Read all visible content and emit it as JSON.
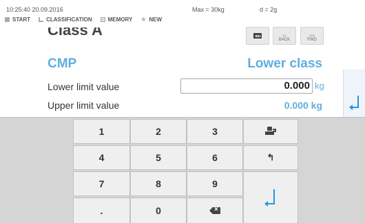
{
  "status": {
    "time": "10:25:40 20.09.2016",
    "max": "Max = 30kg",
    "d": "d = 2g"
  },
  "breadcrumb": [
    {
      "label": "START",
      "icon": "home-icon"
    },
    {
      "label": "CLASSIFICATION",
      "icon": "classification-icon"
    },
    {
      "label": "MEMORY",
      "icon": "memory-icon"
    },
    {
      "label": "NEW",
      "icon": "star-icon"
    }
  ],
  "header": {
    "section_title": "Class A",
    "grid_icon": "grid-icon",
    "back_label": "BACK",
    "fwd_label": "FWD"
  },
  "content": {
    "cmp_label": "CMP",
    "class_label": "Lower class",
    "lower_limit_label": "Lower limit value",
    "lower_limit_value": "0.000",
    "lower_limit_unit": "kg",
    "upper_limit_label": "Upper limit value",
    "upper_limit_value": "0.000 kg"
  },
  "keypad": {
    "keys": [
      "1",
      "2",
      "3",
      "4",
      "5",
      "6",
      "7",
      "8",
      "9",
      ".",
      "0"
    ],
    "tare_icon": "tare-icon",
    "undo_icon": "undo-icon",
    "backspace_icon": "backspace-icon",
    "enter_icon": "enter-icon"
  },
  "colors": {
    "accent": "#5faedf",
    "enter": "#1e96e1",
    "pad_background": "#d5d5d5",
    "key_background": "#efefef"
  }
}
